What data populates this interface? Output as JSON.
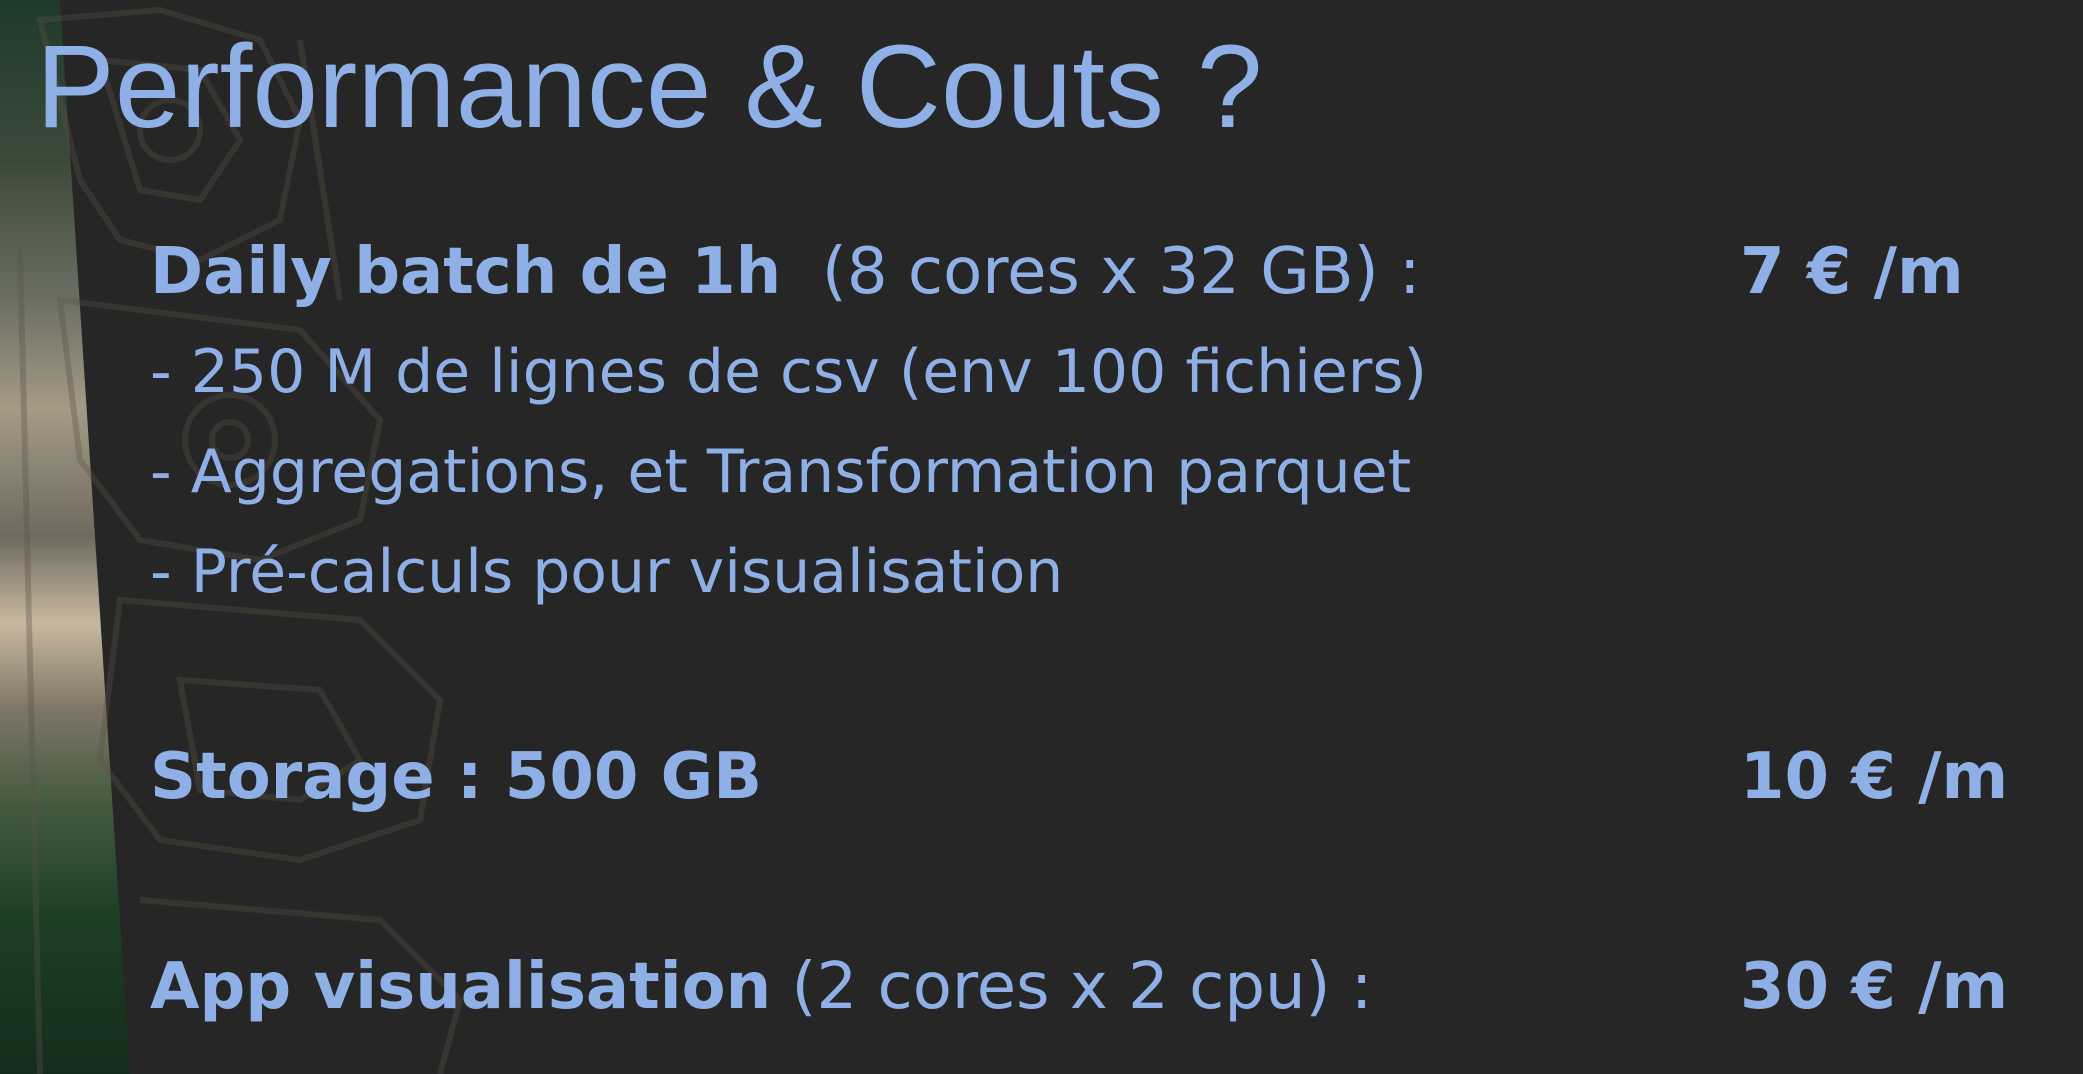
{
  "slide": {
    "title": "Performance & Couts ?",
    "items": [
      {
        "label_bold": "Daily batch de 1h",
        "label_rest": "  (8 cores x 32 GB) :",
        "price": "7 € /m",
        "bullets": [
          "- 250 M de lignes de csv (env 100 fichiers)",
          "- Aggregations, et Transformation parquet",
          "- Pré-calculs pour visualisation"
        ]
      },
      {
        "label_bold": "Storage : 500 GB",
        "label_rest": "",
        "price": "10 € /m"
      },
      {
        "label_bold": "App visualisation",
        "label_rest": " (2 cores x 2 cpu) :",
        "price": "30 € /m"
      }
    ],
    "colors": {
      "background": "#262626",
      "text": "#8fb0e6"
    },
    "icons": {
      "left_decoration": "carved-totem-image"
    }
  }
}
